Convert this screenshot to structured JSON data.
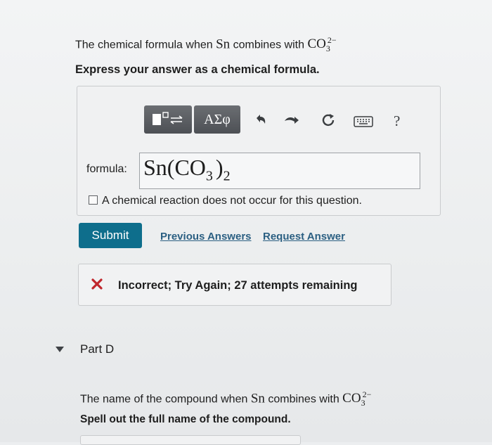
{
  "question": {
    "prefix": "The chemical formula when ",
    "metal": "Sn",
    "middle": " combines with ",
    "ion_base": "CO",
    "ion_sub": "3",
    "ion_charge": "2−",
    "instruction": "Express your answer as a chemical formula."
  },
  "toolbar": {
    "templates_icon": "templates-icon",
    "symbols_label": "ΑΣφ",
    "undo_icon": "undo-icon",
    "redo_icon": "redo-icon",
    "reset_icon": "reset-icon",
    "keyboard_icon": "keyboard-icon",
    "help_label": "?"
  },
  "formula": {
    "label": "formula:",
    "value_prefix": "Sn(CO",
    "value_sub": "3",
    "value_close": ")",
    "value_outer_sub": "2"
  },
  "no_reaction_label": "A chemical reaction does not occur for this question.",
  "actions": {
    "submit_label": "Submit",
    "previous_answers_label": "Previous Answers",
    "request_answer_label": "Request Answer"
  },
  "feedback": {
    "icon": "x-icon",
    "text": "Incorrect; Try Again; 27 attempts remaining",
    "color": "#c0262c"
  },
  "part_d": {
    "title": "Part D",
    "question_prefix": "The name of the compound when ",
    "metal": "Sn",
    "middle": " combines with ",
    "ion_base": "CO",
    "ion_sub": "3",
    "ion_charge": "2−",
    "instruction": "Spell out the full name of the compound."
  },
  "colors": {
    "submit": "#0e6e8c",
    "link": "#2b5f82"
  }
}
